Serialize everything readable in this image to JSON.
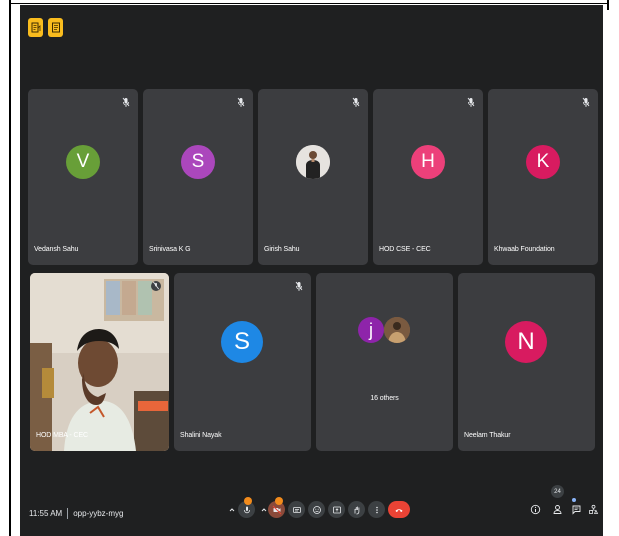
{
  "meeting": {
    "time": "11:55 AM",
    "code": "opp-yybz-myg",
    "participant_count": "24"
  },
  "row1": [
    {
      "name": "Vedansh Sahu",
      "initial": "V",
      "color": "#689f38",
      "type": "letter"
    },
    {
      "name": "Srinivasa K G",
      "initial": "S",
      "color": "#ab47bc",
      "type": "letter"
    },
    {
      "name": "Girish Sahu",
      "initial": "",
      "color": "#c8c8c8",
      "type": "photo"
    },
    {
      "name": "HOD CSE - CEC",
      "initial": "H",
      "color": "#ec407a",
      "type": "letter"
    },
    {
      "name": "Khwaab Foundation",
      "initial": "K",
      "color": "#d81b60",
      "type": "letter"
    }
  ],
  "row2": [
    {
      "name": "HOD MBA - CEC",
      "type": "video"
    },
    {
      "name": "Shalini Nayak",
      "initial": "S",
      "color": "#1e88e5",
      "type": "letter"
    },
    {
      "name": "16 others",
      "initial": "j",
      "color": "#8e24aa",
      "type": "group"
    },
    {
      "name": "Neelam Thakur",
      "initial": "N",
      "color": "#d81b60",
      "type": "letter"
    }
  ],
  "icons": {
    "top_left": [
      "document-icon",
      "notes-icon"
    ],
    "controls": [
      "mic-chevron-icon",
      "mic-icon",
      "camera-chevron-icon",
      "camera-off-icon",
      "captions-icon",
      "emoji-icon",
      "present-icon",
      "raise-hand-icon",
      "more-options-icon",
      "end-call-icon"
    ],
    "right": [
      "info-icon",
      "people-icon",
      "chat-icon",
      "activities-icon"
    ]
  }
}
